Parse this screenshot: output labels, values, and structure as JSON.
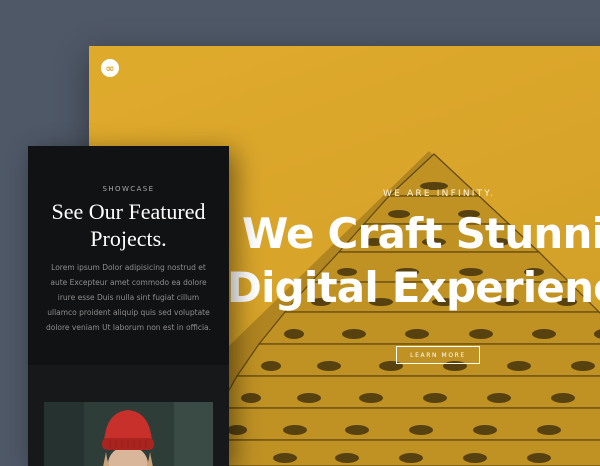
{
  "hero": {
    "logo_glyph": "∞",
    "eyebrow": "WE ARE INFINITY.",
    "headline_line1": "We Craft Stunning",
    "headline_line2": "Digital Experiences",
    "cta_label": "LEARN MORE",
    "accent_color": "#e0ab2c"
  },
  "mobile": {
    "eyebrow": "SHOWCASE",
    "title_line1": "See Our Featured",
    "title_line2": "Projects.",
    "body": "Lorem ipsum Dolor adipisicing nostrud et aute Excepteur amet commodo ea dolore irure esse Duis nulla sint fugiat cillum ullamco proident aliquip quis sed voluptate dolore veniam Ut laborum non est in officia."
  }
}
